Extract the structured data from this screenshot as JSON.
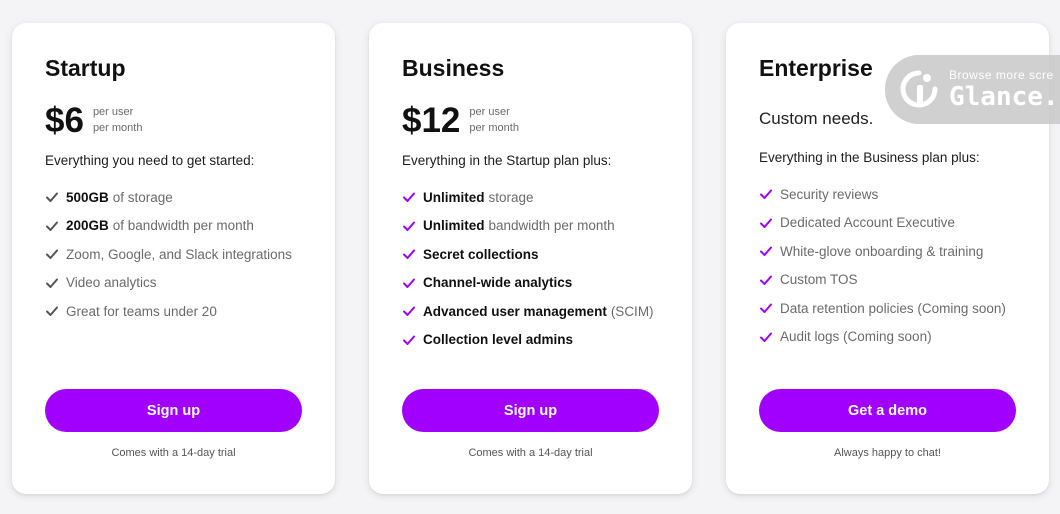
{
  "accent_color": "#a100ff",
  "plans": [
    {
      "name": "Startup",
      "price": "$6",
      "per_line1": "per user",
      "per_line2": "per month",
      "intro": "Everything you need to get started:",
      "check_color": "#555555",
      "features": [
        {
          "strong": "500GB",
          "rest": "of storage"
        },
        {
          "strong": "200GB",
          "rest": "of bandwidth per month"
        },
        {
          "strong": "",
          "rest": "Zoom, Google, and Slack integrations"
        },
        {
          "strong": "",
          "rest": "Video analytics"
        },
        {
          "strong": "",
          "rest": "Great for teams under 20"
        }
      ],
      "cta": "Sign up",
      "note": "Comes with a 14-day trial"
    },
    {
      "name": "Business",
      "price": "$12",
      "per_line1": "per user",
      "per_line2": "per month",
      "intro": "Everything in the Startup plan plus:",
      "check_color": "#a100ff",
      "features": [
        {
          "strong": "Unlimited",
          "rest": "storage"
        },
        {
          "strong": "Unlimited",
          "rest": "bandwidth per month"
        },
        {
          "strong": "Secret collections",
          "rest": ""
        },
        {
          "strong": "Channel-wide analytics",
          "rest": ""
        },
        {
          "strong": "Advanced user management",
          "rest": "(SCIM)"
        },
        {
          "strong": "Collection level admins",
          "rest": ""
        }
      ],
      "cta": "Sign up",
      "note": "Comes with a 14-day trial"
    },
    {
      "name": "Enterprise",
      "custom": "Custom needs.",
      "intro": "Everything in the Business plan plus:",
      "check_color": "#a100ff",
      "features": [
        {
          "strong": "",
          "rest": "Security reviews"
        },
        {
          "strong": "",
          "rest": "Dedicated Account Executive"
        },
        {
          "strong": "",
          "rest": "White-glove onboarding & training"
        },
        {
          "strong": "",
          "rest": "Custom TOS"
        },
        {
          "strong": "",
          "rest": "Data retention policies (Coming soon)"
        },
        {
          "strong": "",
          "rest": "Audit logs (Coming soon)"
        }
      ],
      "cta": "Get a demo",
      "note": "Always happy to chat!"
    }
  ],
  "watermark": {
    "top_text": "Browse more scre",
    "brand": "Glance.",
    "icon": "glance-logo-icon"
  }
}
